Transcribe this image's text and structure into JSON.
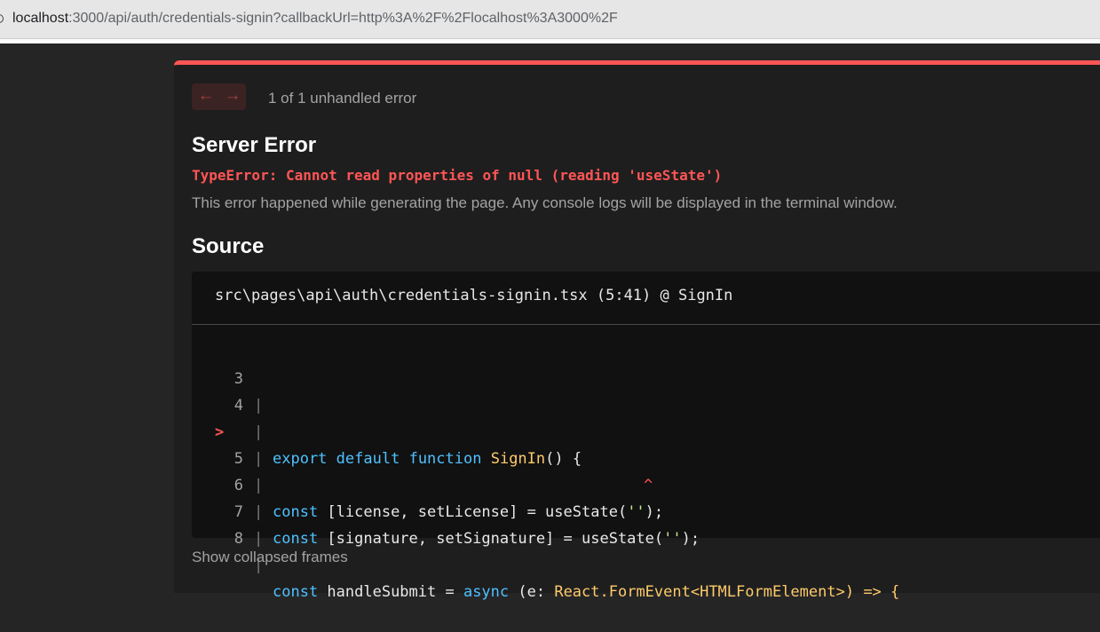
{
  "browser": {
    "url_host": "localhost",
    "url_rest": ":3000/api/auth/credentials-signin?callbackUrl=http%3A%2F%2Flocalhost%3A3000%2F"
  },
  "overlay": {
    "nav": {
      "prev_icon": "←",
      "next_icon": "→"
    },
    "error_count": "1 of 1 unhandled error",
    "title": "Server Error",
    "error_message": "TypeError: Cannot read properties of null (reading 'useState')",
    "error_description": "This error happened while generating the page. Any console logs will be displayed in the terminal window.",
    "source_heading": "Source",
    "source_file": "src\\pages\\api\\auth\\credentials-signin.tsx (5:41) @ SignIn",
    "code_lines": {
      "l3": {
        "num": "3"
      },
      "l4": {
        "num": "4",
        "kw1": "export",
        "kw2": "default",
        "kw3": "function",
        "fn": "SignIn",
        "rest": "() {"
      },
      "l5": {
        "marker": ">",
        "num": "5",
        "kw": "const",
        "mid": " [license, setLicense] = useState(",
        "str": "''",
        "end": ");"
      },
      "caret": {
        "symbol": "^"
      },
      "l6": {
        "num": "6",
        "kw": "const",
        "mid": " [signature, setSignature] = useState(",
        "str": "''",
        "end": ");"
      },
      "l7": {
        "num": "7"
      },
      "l8": {
        "num": "8",
        "kw": "const",
        "mid1": " handleSubmit = ",
        "kw2": "async",
        "mid2": " (e: ",
        "ty": "React.FormEvent<HTMLFormElement>",
        "end": ") => {"
      }
    },
    "collapsed_frames": "Show collapsed frames"
  },
  "colors": {
    "accent_red": "#ff5555",
    "background": "#1e1e1e",
    "code_background": "#111111",
    "keyword_blue": "#4fc1ff",
    "function_yellow": "#ffcb6b",
    "string_green": "#c3e88d"
  }
}
